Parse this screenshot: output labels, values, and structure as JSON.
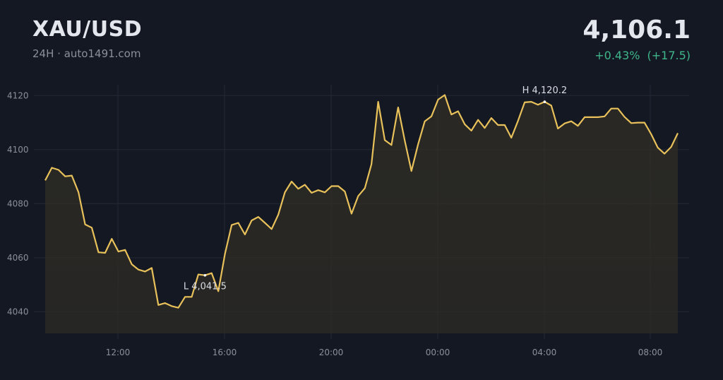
{
  "header": {
    "pair": "XAU/USD",
    "period": "24H",
    "separator": "·",
    "source": "auto1491.com",
    "price": "4,106.1",
    "change_pct": "+0.43%",
    "change_abs": "(+17.5)"
  },
  "colors": {
    "background": "#141822",
    "line": "#e8c15a",
    "up": "#3fb68b",
    "grid": "#232836"
  },
  "chart_data": {
    "type": "line",
    "x_tick_labels": [
      "12:00",
      "16:00",
      "20:00",
      "00:00",
      "04:00",
      "08:00"
    ],
    "y_ticks": [
      4040,
      4060,
      4080,
      4100,
      4120
    ],
    "ylim": [
      4032,
      4124
    ],
    "grid": true,
    "high_label": "H 4,120.2",
    "low_label": "L 4,041.5",
    "high_index": 75,
    "low_index": 24,
    "values": [
      4088.6,
      4093.3,
      4092.5,
      4090.1,
      4090.4,
      4084.2,
      4072.3,
      4071.1,
      4062.0,
      4061.8,
      4067.0,
      4062.3,
      4062.9,
      4057.6,
      4055.6,
      4054.9,
      4056.2,
      4042.5,
      4043.2,
      4042.1,
      4041.5,
      4045.5,
      4045.5,
      4053.8,
      4053.5,
      4054.3,
      4047.6,
      4061.5,
      4072.1,
      4072.9,
      4068.6,
      4073.8,
      4075.1,
      4072.9,
      4070.6,
      4075.9,
      4084.2,
      4088.2,
      4085.5,
      4087.0,
      4084.0,
      4085.0,
      4084.2,
      4086.5,
      4086.5,
      4084.5,
      4076.3,
      4082.8,
      4085.7,
      4094.6,
      4117.7,
      4103.5,
      4101.7,
      4115.6,
      4103.3,
      4092.1,
      4102.0,
      4110.5,
      4112.3,
      4118.5,
      4120.2,
      4113.0,
      4114.2,
      4109.4,
      4107.0,
      4111.0,
      4108.0,
      4111.7,
      4109.1,
      4109.1,
      4104.4,
      4110.6,
      4117.5,
      4117.7,
      4116.6,
      4117.7,
      4116.3,
      4107.8,
      4109.7,
      4110.5,
      4108.8,
      4112.0,
      4112.0,
      4112.0,
      4112.3,
      4115.2,
      4115.2,
      4112.1,
      4109.8,
      4110.0,
      4110.0,
      4105.7,
      4100.7,
      4098.5,
      4101.0,
      4106.1
    ]
  }
}
